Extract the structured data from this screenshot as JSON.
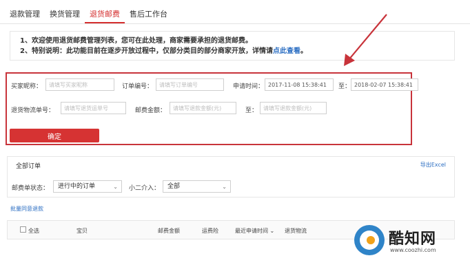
{
  "tabs": [
    {
      "label": "退款管理",
      "active": false
    },
    {
      "label": "换货管理",
      "active": false
    },
    {
      "label": "退货邮费",
      "active": true
    },
    {
      "label": "售后工作台",
      "active": false
    }
  ],
  "notice": {
    "line1": "1、欢迎使用退货邮费管理列表，您可在此处理，商家需要承担的退货邮费。",
    "line2_prefix": "2、特别说明：此功能目前在逐步开放过程中，仅部分类目的部分商家开放，详情请",
    "line2_link": "点此查看",
    "line2_suffix": "。"
  },
  "filter": {
    "buyer_nick_label": "买家昵称：",
    "buyer_nick_placeholder": "请填写买家昵称",
    "order_no_label": "订单编号：",
    "order_no_placeholder": "请填写订单编号",
    "apply_time_label": "申请时间：",
    "apply_time_start": "2017-11-08 15:38:41",
    "to_label_1": "至：",
    "apply_time_end": "2018-02-07 15:38:41",
    "logistics_label": "退货物流单号：",
    "logistics_placeholder": "请填写退货运单号",
    "postage_label": "邮费金额：",
    "postage_min_placeholder": "请填写退款金额(元)",
    "to_label_2": "至：",
    "postage_max_placeholder": "请填写退款金额(元)",
    "confirm_label": "确定"
  },
  "orders": {
    "title": "全部订单",
    "export_label": "导出Excel",
    "status_label": "邮费单状态：",
    "status_value": "进行中的订单",
    "xiaoer_label": "小二介入：",
    "xiaoer_value": "全部"
  },
  "batch_label": "批量同意退款",
  "table": {
    "select_all": "全选",
    "col_item": "宝贝",
    "col_postage": "邮费金额",
    "col_insurance": "运费险",
    "col_apply_time": "最近申请时间",
    "col_logistics": "退货物流"
  },
  "watermark": {
    "name": "酷知网",
    "url": "www.coozhi.com"
  },
  "colors": {
    "accent_red": "#d63333",
    "link_blue": "#2a6dc2",
    "annotation_red": "#c8333a"
  }
}
